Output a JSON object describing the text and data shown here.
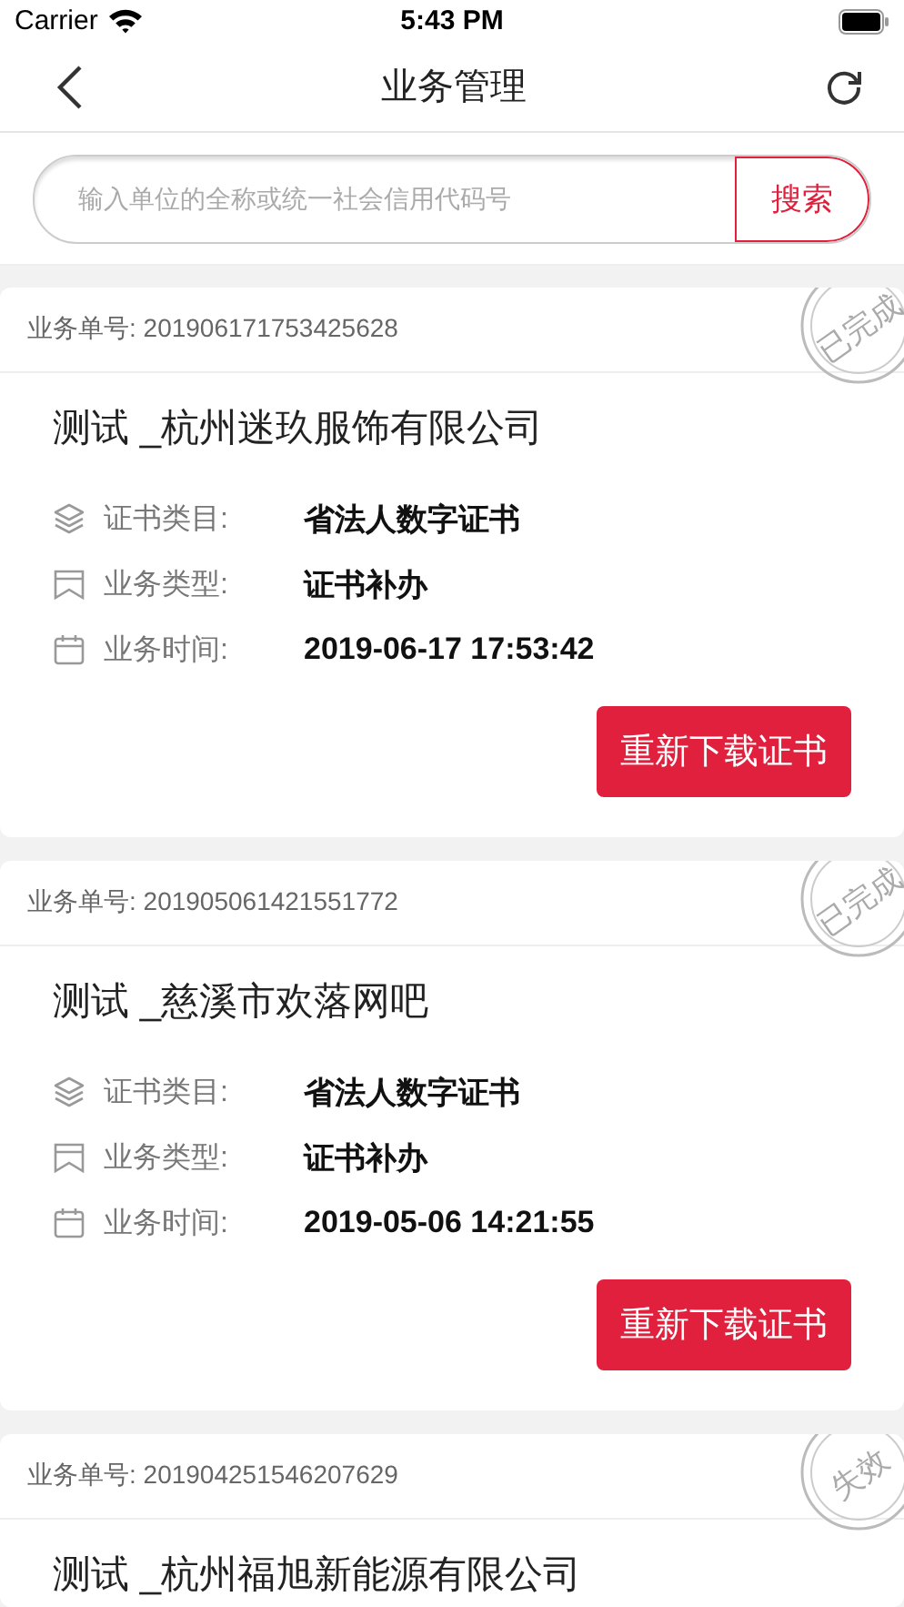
{
  "status_bar": {
    "carrier": "Carrier",
    "time": "5:43 PM"
  },
  "nav": {
    "title": "业务管理"
  },
  "search": {
    "placeholder": "输入单位的全称或统一社会信用代码号",
    "button": "搜索"
  },
  "records": [
    {
      "number_label": "业务单号:",
      "number": "201906171753425628",
      "stamp": "已完成",
      "title": "测试 _杭州迷玖服饰有限公司",
      "fields": [
        {
          "kind": "layers",
          "label": "证书类目:",
          "value": "省法人数字证书"
        },
        {
          "kind": "bookmark",
          "label": "业务类型:",
          "value": "证书补办"
        },
        {
          "kind": "calendar",
          "label": "业务时间:",
          "value": "2019-06-17 17:53:42"
        }
      ],
      "action": "重新下载证书"
    },
    {
      "number_label": "业务单号:",
      "number": "201905061421551772",
      "stamp": "已完成",
      "title": "测试 _慈溪市欢落网吧",
      "fields": [
        {
          "kind": "layers",
          "label": "证书类目:",
          "value": "省法人数字证书"
        },
        {
          "kind": "bookmark",
          "label": "业务类型:",
          "value": "证书补办"
        },
        {
          "kind": "calendar",
          "label": "业务时间:",
          "value": "2019-05-06 14:21:55"
        }
      ],
      "action": "重新下载证书"
    },
    {
      "number_label": "业务单号:",
      "number": "201904251546207629",
      "stamp": "失效",
      "title": "测试 _杭州福旭新能源有限公司"
    }
  ]
}
